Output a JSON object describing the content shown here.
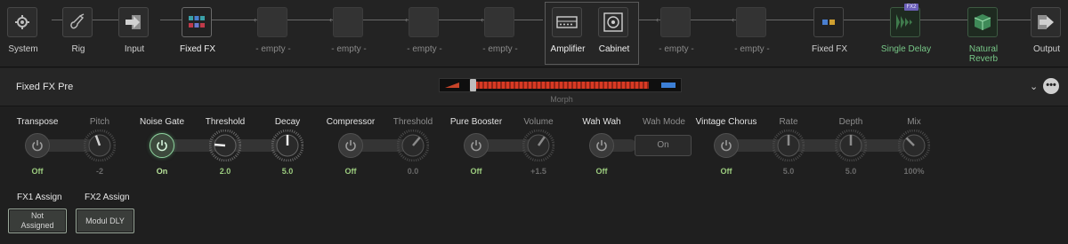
{
  "chain": {
    "slots": [
      {
        "label": "System",
        "icon": "gear-icon"
      },
      {
        "label": "Rig",
        "icon": "guitar-icon"
      },
      {
        "label": "Input",
        "icon": "input-arrow-icon"
      },
      {
        "label": "Fixed FX",
        "icon": "fixed-fx-grid-icon"
      },
      {
        "label": "- empty -"
      },
      {
        "label": "- empty -"
      },
      {
        "label": "- empty -"
      },
      {
        "label": "- empty -"
      },
      {
        "label": "Amplifier",
        "icon": "amplifier-icon"
      },
      {
        "label": "Cabinet",
        "icon": "cabinet-speaker-icon"
      },
      {
        "label": "- empty -"
      },
      {
        "label": "- empty -"
      },
      {
        "label": "Fixed FX",
        "icon": "fixed-fx-icon"
      },
      {
        "label": "Single Delay",
        "icon": "delay-waveform-icon",
        "badge": "FX2"
      },
      {
        "label": "Natural Reverb",
        "icon": "reverb-cube-icon"
      },
      {
        "label": "Output",
        "icon": "output-arrow-icon"
      }
    ]
  },
  "header": {
    "title": "Fixed FX Pre",
    "morph_label": "Morph",
    "morph_position": 0.0
  },
  "params": {
    "transpose": {
      "label": "Transpose",
      "value": "Off"
    },
    "pitch": {
      "label": "Pitch",
      "value": "-2"
    },
    "noise_gate": {
      "label": "Noise Gate",
      "value": "On"
    },
    "threshold": {
      "label": "Threshold",
      "value": "2.0"
    },
    "decay": {
      "label": "Decay",
      "value": "5.0"
    },
    "compressor": {
      "label": "Compressor",
      "value": "Off"
    },
    "comp_threshold": {
      "label": "Threshold",
      "value": "0.0"
    },
    "pure_booster": {
      "label": "Pure Booster",
      "value": "Off"
    },
    "volume": {
      "label": "Volume",
      "value": "+1.5"
    },
    "wah_wah": {
      "label": "Wah Wah",
      "value": "Off"
    },
    "wah_mode": {
      "label": "Wah Mode",
      "value": "On"
    },
    "vintage_chorus": {
      "label": "Vintage Chorus",
      "value": "Off"
    },
    "rate": {
      "label": "Rate",
      "value": "5.0"
    },
    "depth": {
      "label": "Depth",
      "value": "5.0"
    },
    "mix": {
      "label": "Mix",
      "value": "100%"
    }
  },
  "assign": {
    "fx1": {
      "label": "FX1 Assign",
      "value": "Not Assigned"
    },
    "fx2": {
      "label": "FX2 Assign",
      "value": "Modul DLY"
    }
  },
  "colors": {
    "accent_green": "#77c787",
    "value_green": "#9ccc7f",
    "morph_red": "#d83a24",
    "morph_blue": "#3c7fd6",
    "fx2_badge": "#6b5fb8"
  }
}
